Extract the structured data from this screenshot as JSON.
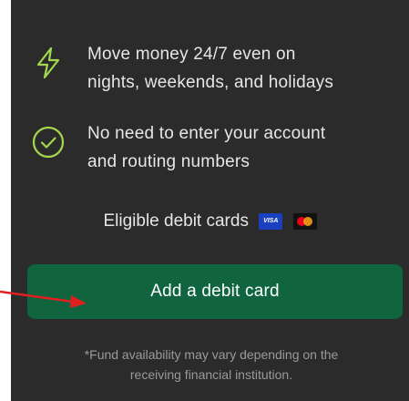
{
  "features": [
    {
      "icon": "lightning-bolt-icon",
      "lines": [
        "Move money 24/7 even on",
        "nights, weekends, and holidays"
      ]
    },
    {
      "icon": "check-circle-icon",
      "lines": [
        "No need to enter your account",
        "and routing numbers"
      ]
    }
  ],
  "eligible": {
    "label": "Eligible debit cards",
    "cards": [
      {
        "name": "visa-card-icon",
        "text": "VISA"
      },
      {
        "name": "mastercard-card-icon",
        "text": ""
      }
    ]
  },
  "cta": {
    "label": "Add a debit card"
  },
  "footnote": {
    "lines": [
      "*Fund availability may vary depending on the",
      "receiving financial institution."
    ]
  },
  "colors": {
    "background": "#2b2b2b",
    "accent_green": "#a3d84e",
    "button_green": "#10653f",
    "annotation_red": "#e02020"
  }
}
